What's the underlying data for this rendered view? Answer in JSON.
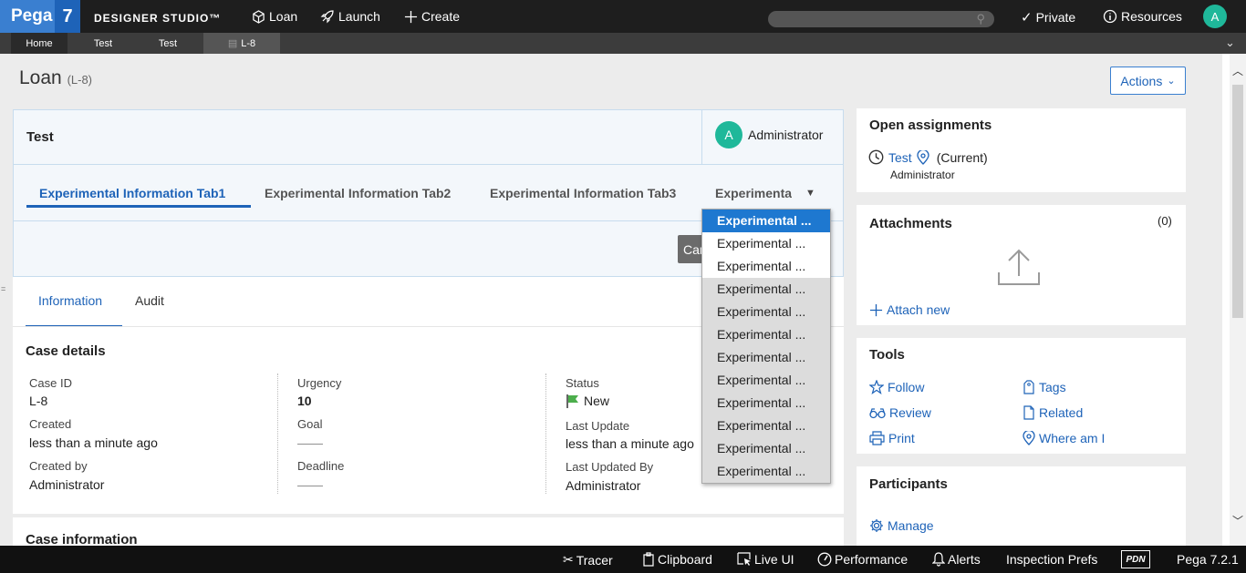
{
  "header": {
    "logo_text": "Pega",
    "logo_version": "7",
    "brand": "DESIGNER STUDIO™",
    "nav": [
      "Loan",
      "Launch",
      "Create"
    ],
    "private_label": "Private",
    "resources_label": "Resources",
    "avatar_letter": "A",
    "search_placeholder": ""
  },
  "tabs": [
    "Home",
    "Test",
    "Test",
    "L-8"
  ],
  "page": {
    "title": "Loan",
    "case_id_suffix": "(L-8)",
    "actions_label": "Actions"
  },
  "stage": {
    "name": "Test",
    "assignee_letter": "A",
    "assignee": "Administrator",
    "tabs": [
      "Experimental Information Tab1",
      "Experimental Information Tab2",
      "Experimental Information Tab3",
      "Experimenta"
    ],
    "cancel_partial": "Car"
  },
  "dropdown": {
    "items": [
      "Experimental ...",
      "Experimental ...",
      "Experimental ...",
      "Experimental ...",
      "Experimental ...",
      "Experimental ...",
      "Experimental ...",
      "Experimental ...",
      "Experimental ...",
      "Experimental ...",
      "Experimental ...",
      "Experimental ..."
    ]
  },
  "info_tabs": [
    "Information",
    "Audit"
  ],
  "case_details": {
    "heading": "Case details",
    "case_id_label": "Case ID",
    "case_id": "L-8",
    "created_label": "Created",
    "created": "less than a minute ago",
    "created_by_label": "Created by",
    "created_by": "Administrator",
    "urgency_label": "Urgency",
    "urgency": "10",
    "goal_label": "Goal",
    "goal": "——",
    "deadline_label": "Deadline",
    "deadline": "——",
    "status_label": "Status",
    "status": "New",
    "last_update_label": "Last Update",
    "last_update": "less than a minute ago",
    "last_updated_by_label": "Last Updated By",
    "last_updated_by": "Administrator"
  },
  "case_information": {
    "heading": "Case information"
  },
  "open_assignments": {
    "heading": "Open assignments",
    "item": "Test",
    "current": "(Current)",
    "assignee": "Administrator"
  },
  "attachments": {
    "heading": "Attachments",
    "count": "(0)",
    "attach_label": "Attach new"
  },
  "tools": {
    "heading": "Tools",
    "items": [
      "Follow",
      "Tags",
      "Review",
      "Related",
      "Print",
      "Where am I"
    ]
  },
  "participants": {
    "heading": "Participants",
    "manage_label": "Manage"
  },
  "footer": {
    "items": [
      "Tracer",
      "Clipboard",
      "Live UI",
      "Performance",
      "Alerts",
      "Inspection Prefs"
    ],
    "pdn": "PDN",
    "version": "Pega 7.2.1"
  },
  "colors": {
    "accent": "#1e63b8",
    "brand_blue": "#3a7fd0",
    "avatar": "#1fb89a",
    "dropdown_selected": "#1e78d0"
  }
}
